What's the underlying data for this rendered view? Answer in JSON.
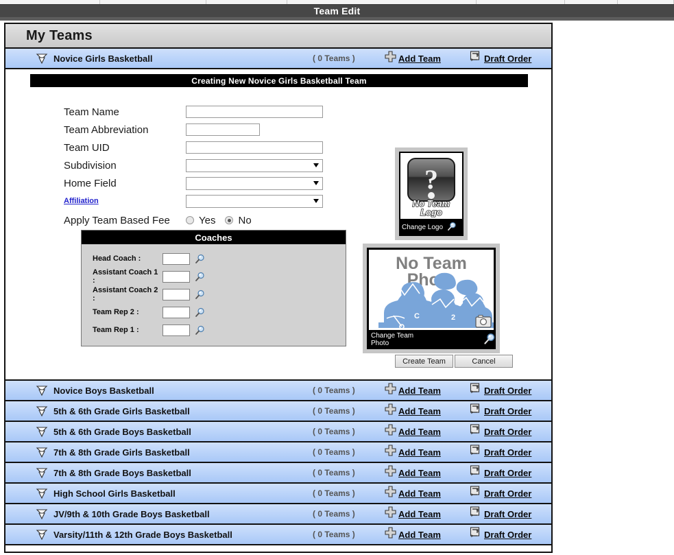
{
  "window": {
    "title": "Team Edit"
  },
  "page": {
    "header_title": "My Teams"
  },
  "form": {
    "title": "Creating New Novice Girls Basketball Team",
    "fields": [
      {
        "label": "Team Name",
        "type": "text",
        "value": "",
        "width": "wide"
      },
      {
        "label": "Team Abbreviation",
        "type": "text",
        "value": "",
        "width": "short"
      },
      {
        "label": "Team UID",
        "type": "text",
        "value": "",
        "width": "wide"
      },
      {
        "label": "Subdivision",
        "type": "select",
        "value": ""
      },
      {
        "label": "Home Field",
        "type": "select",
        "value": ""
      },
      {
        "label": "Affiliation",
        "type": "select",
        "value": "",
        "is_link": true
      }
    ],
    "fee_label": "Apply Team Based Fee",
    "fee_options": [
      {
        "label": "Yes",
        "selected": false
      },
      {
        "label": "No",
        "selected": true
      }
    ],
    "coaches": {
      "title": "Coaches",
      "rows": [
        {
          "label": "Head Coach :",
          "value": ""
        },
        {
          "label": "Assistant Coach 1 :",
          "value": ""
        },
        {
          "label": "Assistant Coach 2 :",
          "value": ""
        },
        {
          "label": "Team Rep 2 :",
          "value": ""
        },
        {
          "label": "Team Rep 1 :",
          "value": ""
        }
      ]
    },
    "logo": {
      "placeholder_line1": "No Team",
      "placeholder_line2": "Logo",
      "caption": "Change Logo"
    },
    "photo": {
      "placeholder_line1": "No Team",
      "placeholder_line2": "Photo",
      "caption": "Change Team Photo"
    },
    "buttons": {
      "create": "Create Team",
      "cancel": "Cancel"
    }
  },
  "divisions": [
    {
      "name": "Novice Girls Basketball",
      "count": "( 0 Teams )",
      "add": "Add Team",
      "draft": "Draft Order",
      "expanded": true
    },
    {
      "name": "Novice Boys Basketball",
      "count": "( 0 Teams )",
      "add": "Add Team",
      "draft": "Draft Order",
      "expanded": false
    },
    {
      "name": "5th & 6th Grade Girls Basketball",
      "count": "( 0 Teams )",
      "add": "Add Team",
      "draft": "Draft Order",
      "expanded": false
    },
    {
      "name": "5th & 6th Grade Boys Basketball",
      "count": "( 0 Teams )",
      "add": "Add Team",
      "draft": "Draft Order",
      "expanded": false
    },
    {
      "name": "7th & 8th Grade Girls Basketball",
      "count": "( 0 Teams )",
      "add": "Add Team",
      "draft": "Draft Order",
      "expanded": false
    },
    {
      "name": "7th & 8th Grade Boys Basketball",
      "count": "( 0 Teams )",
      "add": "Add Team",
      "draft": "Draft Order",
      "expanded": false
    },
    {
      "name": "High School Girls Basketball",
      "count": "( 0 Teams )",
      "add": "Add Team",
      "draft": "Draft Order",
      "expanded": false
    },
    {
      "name": "JV/9th & 10th Grade Boys Basketball",
      "count": "( 0 Teams )",
      "add": "Add Team",
      "draft": "Draft Order",
      "expanded": false
    },
    {
      "name": "Varsity/11th & 12th Grade Boys Basketball",
      "count": "( 0 Teams )",
      "add": "Add Team",
      "draft": "Draft Order",
      "expanded": false
    }
  ],
  "colors": {
    "titlebar": "#474747",
    "row_blue": "#bed6fa",
    "header_gray": "#d6d6d6",
    "black_bar": "#000000",
    "link_blue": "#2222cc",
    "photo_art_blue": "#79a5d9"
  }
}
